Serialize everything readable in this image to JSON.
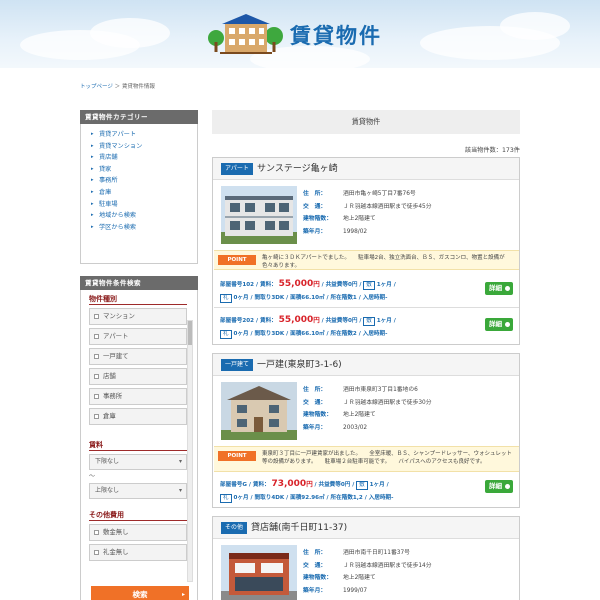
{
  "site": {
    "logo_text": "賃貸物件"
  },
  "breadcrumb": {
    "home": "トップページ",
    "sep": " ＞ ",
    "current": "賃貸物件情報"
  },
  "sidebar": {
    "category_title": "賃貸物件カテゴリー",
    "categories": [
      "賃貸アパート",
      "賃貸マンション",
      "賃店舗",
      "貸家",
      "事務所",
      "倉庫",
      "駐車場",
      "地域から検索",
      "学区から検索"
    ],
    "search_title": "賃貸物件条件検索",
    "type_label": "物件種別",
    "types": [
      "マンション",
      "アパート",
      "一戸建て",
      "店舗",
      "事務所",
      "倉庫"
    ],
    "rent_label": "賃料",
    "rent_min": "下限なし",
    "rent_sep": "〜",
    "rent_max": "上限なし",
    "other_label": "その他費用",
    "others": [
      "敷金無し",
      "礼金無し"
    ],
    "search_button": "検索"
  },
  "main": {
    "title": "賃貸物件",
    "count": "該当物件数：173件",
    "labels": {
      "address": "住　所：",
      "traffic": "交　通：",
      "structure": "建物階数：",
      "built": "築年月：",
      "point": "POINT"
    },
    "properties": [
      {
        "type": "アパート",
        "name": "サンステージ亀ヶ崎",
        "address": "酒田市亀ヶ崎5丁目7番76号",
        "traffic": "ＪＲ羽越本線酒田駅まで徒歩45分",
        "structure": "地上2階建て",
        "built": "1998/02",
        "point": "亀ヶ崎に３ＤＫアパートでました。　　駐車場2台、独立洗面台、ＢＳ、ガスコンロ、物置と設備が色々あります。",
        "rooms": [
          {
            "line1": "部屋番号102 / 賃料：",
            "price": "55,000",
            "unit": "円",
            "line1b": "/ 共益費等0円 /",
            "deposit_tag": "敷",
            "deposit": "1ヶ月 /",
            "key_tag": "礼",
            "key": "0ヶ月 / 間取り3DK / 面積66.10㎡ / 所在階数1 / 入居時期-",
            "detail": "詳細"
          },
          {
            "line1": "部屋番号202 / 賃料：",
            "price": "55,000",
            "unit": "円",
            "line1b": "/ 共益費等0円 /",
            "deposit_tag": "敷",
            "deposit": "1ヶ月 /",
            "key_tag": "礼",
            "key": "0ヶ月 / 間取り3DK / 面積66.10㎡ / 所在階数2 / 入居時期-",
            "detail": "詳細"
          }
        ]
      },
      {
        "type": "一戸建て",
        "name": "一戸建(東泉町3-1-6)",
        "address": "酒田市東泉町3丁目1番地の6",
        "traffic": "ＪＲ羽越本線酒田駅まで徒歩30分",
        "structure": "地上2階建て",
        "built": "2003/02",
        "point": "東泉町３丁目に一戸建賃家が出ました。　　全室床暖、ＢＳ、シャンプードレッサー、ウォシュレット等の設備があります。　　駐車場２台駐車可能です。　　バイパスへのアクセスも良好です。",
        "rooms": [
          {
            "line1": "部屋番号G / 賃料：",
            "price": "73,000",
            "unit": "円",
            "line1b": "/ 共益費等0円 /",
            "deposit_tag": "敷",
            "deposit": "1ヶ月 /",
            "key_tag": "礼",
            "key": "0ヶ月 / 間取り4DK / 面積92.96㎡ / 所在階数1,2 / 入居時期-",
            "detail": "詳細"
          }
        ]
      },
      {
        "type": "その他",
        "name": "貸店舗(南千日町11-37)",
        "address": "酒田市南千日町11番37号",
        "traffic": "ＪＲ羽越本線酒田駅まで徒歩14分",
        "structure": "地上2階建て",
        "built": "1999/07"
      }
    ]
  },
  "colors": {
    "brand": "#1a6bb0",
    "accent": "#f07127",
    "price": "#d8232a",
    "detail": "#3aa83a"
  }
}
